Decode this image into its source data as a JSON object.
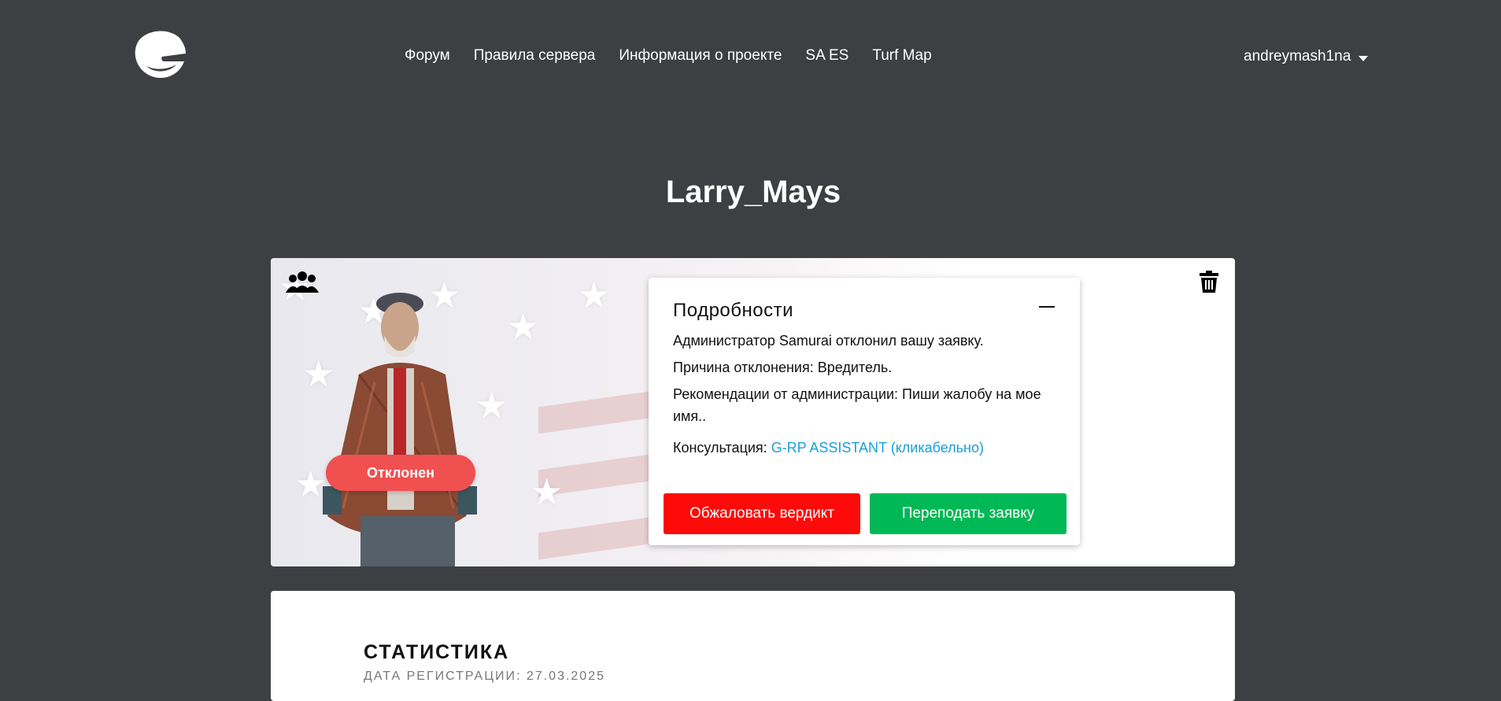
{
  "nav": {
    "items": [
      "Форум",
      "Правила сервера",
      "Информация о проекте",
      "SA ES",
      "Turf Map"
    ]
  },
  "user": {
    "name": "andreymash1na"
  },
  "page": {
    "title": "Larry_Mays"
  },
  "card": {
    "status": "Отклонен",
    "details": {
      "title": "Подробности",
      "line1": "Администратор Samurai отклонил вашу заявку.",
      "line2": "Причина отклонения: Вредитель.",
      "line3": "Рекомендации от администрации: Пиши жалобу на мое имя..",
      "consult_label": "Консультация: ",
      "consult_link": "G-RP ASSISTANT (кликабельно)"
    },
    "buttons": {
      "appeal": "Обжаловать вердикт",
      "resubmit": "Переподать заявку"
    }
  },
  "stats": {
    "title": "СТАТИСТИКА",
    "registration": "ДАТА РЕГИСТРАЦИИ: 27.03.2025"
  },
  "colors": {
    "background": "#3e3f42",
    "status_rejected": "#f05050",
    "appeal_button": "#ff0a0a",
    "resubmit_button": "#00b856",
    "link": "#1a9fd6"
  },
  "icons": [
    "logo-icon",
    "group-icon",
    "trash-icon",
    "caret-down-icon",
    "minimize-icon"
  ]
}
